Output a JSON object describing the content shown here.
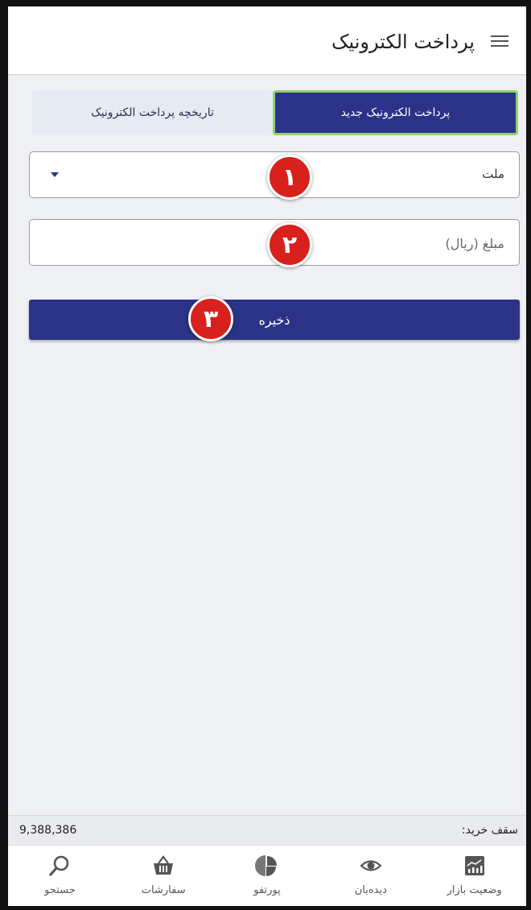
{
  "header": {
    "title": "پرداخت الکترونیک",
    "menu_icon": "hamburger-menu-icon"
  },
  "tabs": [
    {
      "label": "پرداخت الکترونیک جدید",
      "active": true
    },
    {
      "label": "تاریخچه پرداخت الکترونیک",
      "active": false
    }
  ],
  "form": {
    "bank_select": {
      "value": "ملت",
      "icon": "dropdown-caret-icon"
    },
    "amount_input": {
      "value": "",
      "placeholder": "مبلغ (ریال)"
    },
    "save_label": "ذخیره"
  },
  "annotations": [
    "۱",
    "۲",
    "۳"
  ],
  "purchase_limit": {
    "label": "سقف خرید:",
    "value": "9,388,386"
  },
  "bottom_nav": [
    {
      "label": "وضعیت بازار",
      "icon": "market-chart-icon"
    },
    {
      "label": "دیده‌بان",
      "icon": "eye-icon"
    },
    {
      "label": "پورتفو",
      "icon": "portfolio-pie-icon"
    },
    {
      "label": "سفارشات",
      "icon": "basket-icon"
    },
    {
      "label": "جستجو",
      "icon": "search-icon"
    }
  ],
  "colors": {
    "primary": "#2b3388",
    "tab_highlight": "#8fd46a",
    "badge": "#d8201c",
    "background": "#eff0f3"
  }
}
